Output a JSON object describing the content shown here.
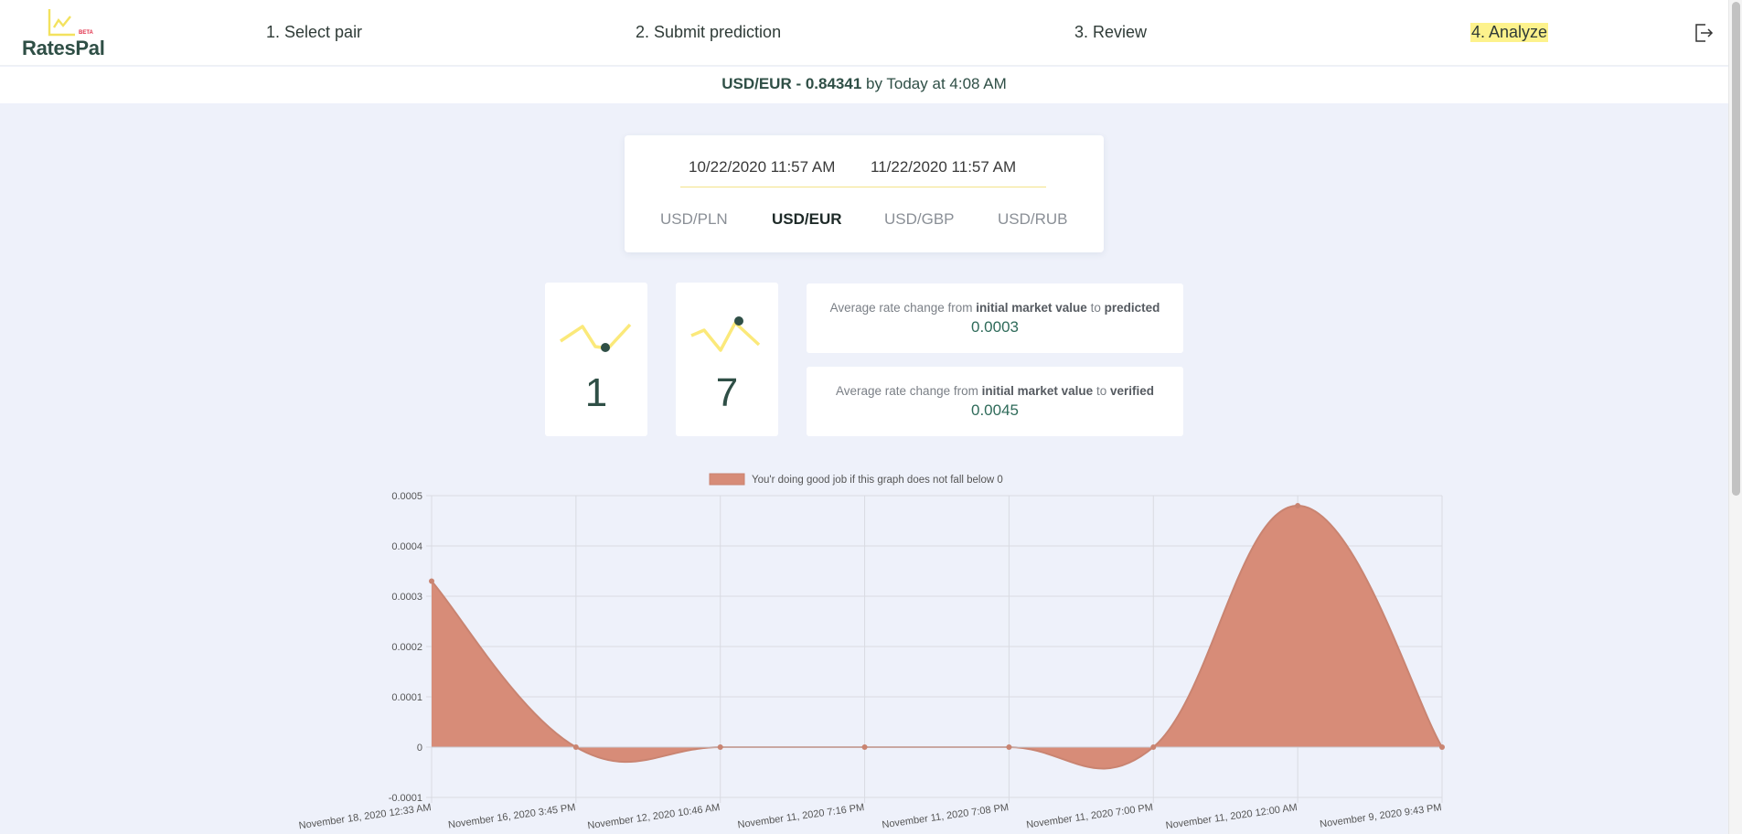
{
  "app": {
    "name": "RatesPal",
    "badge": "BETA"
  },
  "nav": [
    {
      "label": "1. Select pair",
      "active": false
    },
    {
      "label": "2. Submit prediction",
      "active": false
    },
    {
      "label": "3. Review",
      "active": false
    },
    {
      "label": "4. Analyze",
      "active": true
    }
  ],
  "icons": {
    "logout": "logout-icon",
    "logo": "chart-line-icon",
    "trend_down": "trend-down-icon",
    "trend_up": "trend-up-icon"
  },
  "rate": {
    "pair_value": "USD/EUR - 0.84341",
    "suffix": "by Today at 4:08 AM"
  },
  "filter": {
    "date_from": "10/22/2020 11:57 AM",
    "date_to": "11/22/2020 11:57 AM",
    "pairs": [
      "USD/PLN",
      "USD/EUR",
      "USD/GBP",
      "USD/RUB"
    ],
    "selected_pair": "USD/EUR"
  },
  "stats": [
    {
      "icon": "trend-down-icon",
      "value": "1"
    },
    {
      "icon": "trend-up-icon",
      "value": "7"
    }
  ],
  "averages": [
    {
      "prefix": "Average rate change from",
      "bold1": "initial market value",
      "mid": "to",
      "bold2": "predicted",
      "value": "0.0003"
    },
    {
      "prefix": "Average rate change from",
      "bold1": "initial market value",
      "mid": "to",
      "bold2": "verified",
      "value": "0.0045"
    }
  ],
  "colors": {
    "accent": "#fdf28c",
    "brand_green": "#2f4f46",
    "area_fill": "#d78c78",
    "area_stroke": "#c98471"
  },
  "chart_data": {
    "type": "area",
    "legend": "You'r doing good job if this graph does not fall below 0",
    "legend_placement": "top",
    "categories": [
      "November 18, 2020 12:33 AM",
      "November 16, 2020 3:45 PM",
      "November 12, 2020 10:46 AM",
      "November 11, 2020 7:16 PM",
      "November 11, 2020 7:08 PM",
      "November 11, 2020 7:00 PM",
      "November 11, 2020 12:00 AM",
      "November 9, 2020 9:43 PM"
    ],
    "values": [
      0.00033,
      0.0,
      0.0,
      0.0,
      0.0,
      0.0,
      0.00048,
      0.0
    ],
    "ylim": [
      -0.0001,
      0.0005
    ],
    "yticks": [
      "0.0005",
      "0.0004",
      "0.0003",
      "0.0002",
      "0.0001",
      "0",
      "-0.0001"
    ],
    "grid": true
  }
}
